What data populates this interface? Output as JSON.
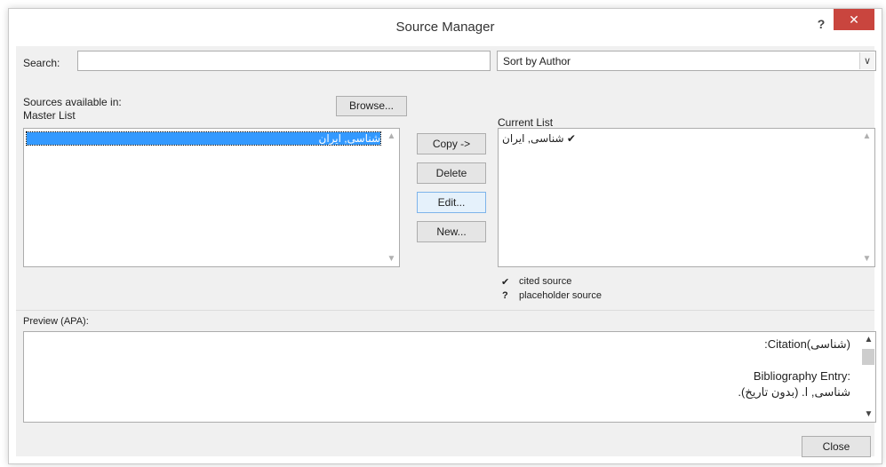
{
  "window": {
    "title": "Source Manager",
    "help": "?",
    "close": "✕"
  },
  "search": {
    "label": "Search:",
    "value": ""
  },
  "sort": {
    "selected": "Sort by Author",
    "arrow": "∨"
  },
  "left": {
    "label_line1": "Sources available in:",
    "label_line2": "Master List",
    "browse": "Browse...",
    "items": [
      "شناسی, ایران"
    ]
  },
  "buttons": {
    "copy": "Copy ->",
    "delete": "Delete",
    "edit": "Edit...",
    "new": "New..."
  },
  "right": {
    "label": "Current List",
    "items": [
      {
        "text": "شناسی, ایران",
        "mark": "✔"
      }
    ]
  },
  "legend": {
    "cited_mark": "✔",
    "cited": "cited source",
    "placeholder_mark": "?",
    "placeholder": "placeholder source"
  },
  "preview": {
    "label": "Preview (APA):",
    "citation": ":Citation(شناسی)",
    "bib_heading": "Bibliography Entry:",
    "bib_text": "شناسی, ا. (بدون تاریخ)."
  },
  "footer": {
    "close": "Close"
  }
}
